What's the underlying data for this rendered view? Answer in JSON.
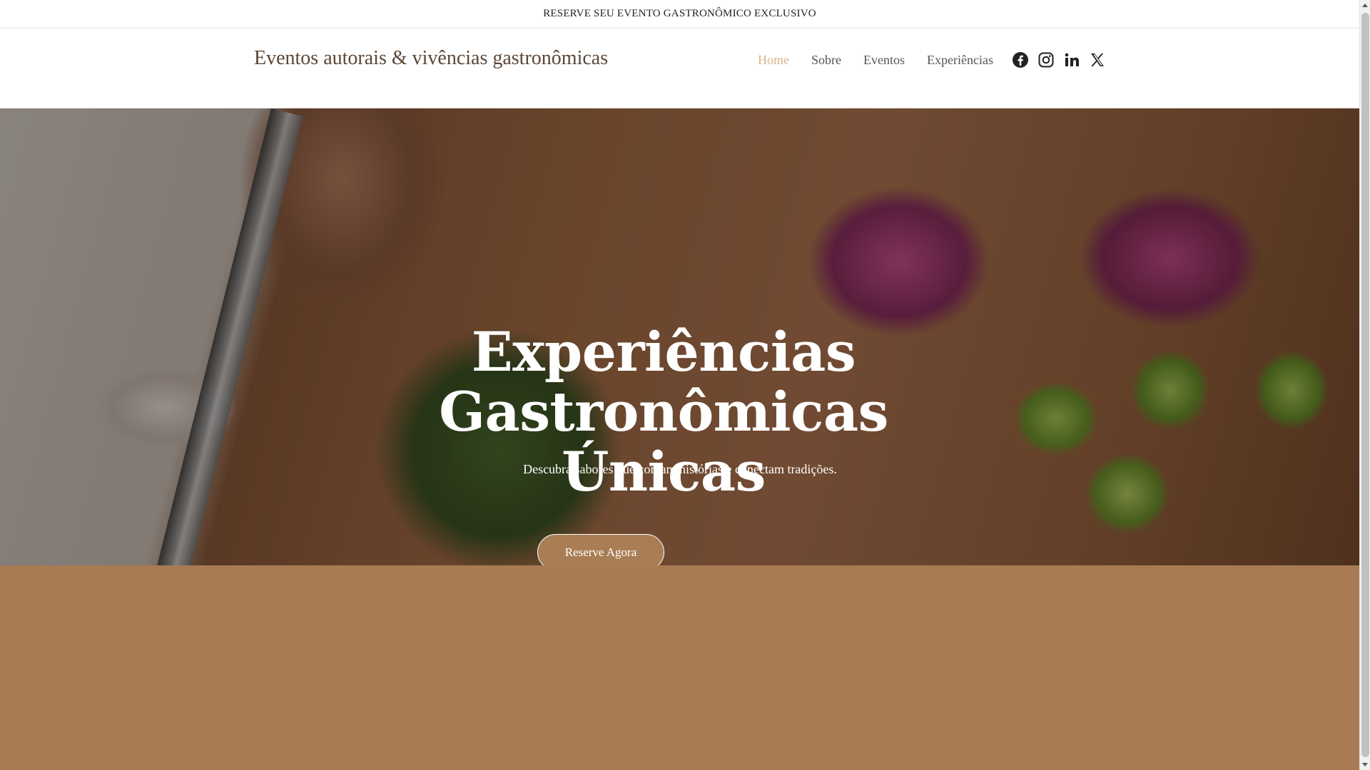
{
  "announcement": {
    "text": "RESERVE SEU EVENTO GASTRONÔMICO EXCLUSIVO"
  },
  "header": {
    "site_title": "Eventos autorais & vivências gastronômicas",
    "nav": [
      {
        "label": "Home",
        "active": true
      },
      {
        "label": "Sobre",
        "active": false
      },
      {
        "label": "Eventos",
        "active": false
      },
      {
        "label": "Experiências",
        "active": false
      }
    ],
    "social": [
      "facebook-icon",
      "instagram-icon",
      "linkedin-icon",
      "x-icon"
    ]
  },
  "hero": {
    "title_line1": "Experiências",
    "title_line2": "Gastronômicas Únicas",
    "subtitle": "Descubra sabores que contam histórias e conectam tradições.",
    "cta_label": "Reserve Agora"
  },
  "colors": {
    "accent": "#a97e55",
    "active_nav": "#d8b58c",
    "section_bg": "#a87b54"
  }
}
